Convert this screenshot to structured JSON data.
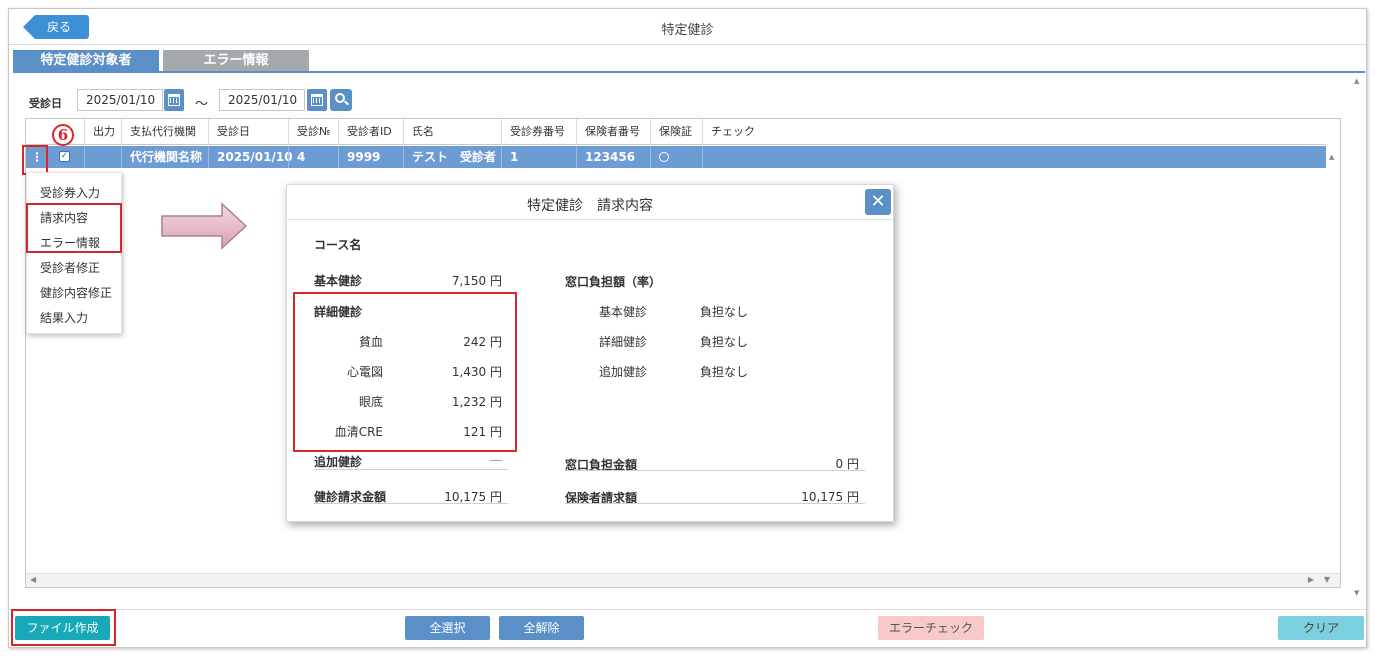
{
  "header": {
    "back_label": "戻る",
    "title": "特定健診"
  },
  "tabs": [
    {
      "label": "特定健診対象者"
    },
    {
      "label": "エラー情報"
    }
  ],
  "filter": {
    "label": "受診日",
    "date_from": "2025/01/10",
    "tilde": "～",
    "date_to": "2025/01/10"
  },
  "table": {
    "columns": [
      "出力",
      "支払代行機関",
      "受診日",
      "受診№",
      "受診者ID",
      "氏名",
      "受診券番号",
      "保険者番号",
      "保険証",
      "チェック"
    ],
    "row": {
      "kebab": "⋮",
      "checkmark": "✓",
      "agency": "代行機関名称",
      "date": "2025/01/10",
      "number": "4",
      "patient_id": "9999",
      "name": "テスト　受診者",
      "ticket_no": "1",
      "insurer_no": "123456"
    }
  },
  "step_marker": "6",
  "context_menu": {
    "items": [
      "受診券入力",
      "請求内容",
      "エラー情報",
      "受診者修正",
      "健診内容修正",
      "結果入力"
    ]
  },
  "modal": {
    "title": "特定健診　請求内容",
    "close": "✕",
    "course_label": "コース名",
    "basic_label": "基本健診",
    "basic_amount": "7,150 円",
    "detail_label": "詳細健診",
    "detail_items": [
      {
        "name": "貧血",
        "amount": "242 円"
      },
      {
        "name": "心電図",
        "amount": "1,430 円"
      },
      {
        "name": "眼底",
        "amount": "1,232 円"
      },
      {
        "name": "血清CRE",
        "amount": "121 円"
      }
    ],
    "additional_label": "追加健診",
    "additional_amount": "―",
    "total_label": "健診請求金額",
    "total_amount": "10,175 円",
    "window_rate_label": "窓口負担額（率）",
    "window_rates": [
      {
        "name": "基本健診",
        "value": "負担なし"
      },
      {
        "name": "詳細健診",
        "value": "負担なし"
      },
      {
        "name": "追加健診",
        "value": "負担なし"
      }
    ],
    "window_amount_label": "窓口負担金額",
    "window_amount": "0 円",
    "insurer_label": "保険者請求額",
    "insurer_amount": "10,175 円"
  },
  "footer": {
    "file_label": "ファイル作成",
    "select_all_label": "全選択",
    "deselect_all_label": "全解除",
    "error_check_label": "エラーチェック",
    "clear_label": "クリア"
  },
  "colors": {
    "accent": "#5b8fc7",
    "row_selected": "#6d9bd3",
    "highlight": "#d9262b",
    "file_button": "#17a9b8"
  }
}
